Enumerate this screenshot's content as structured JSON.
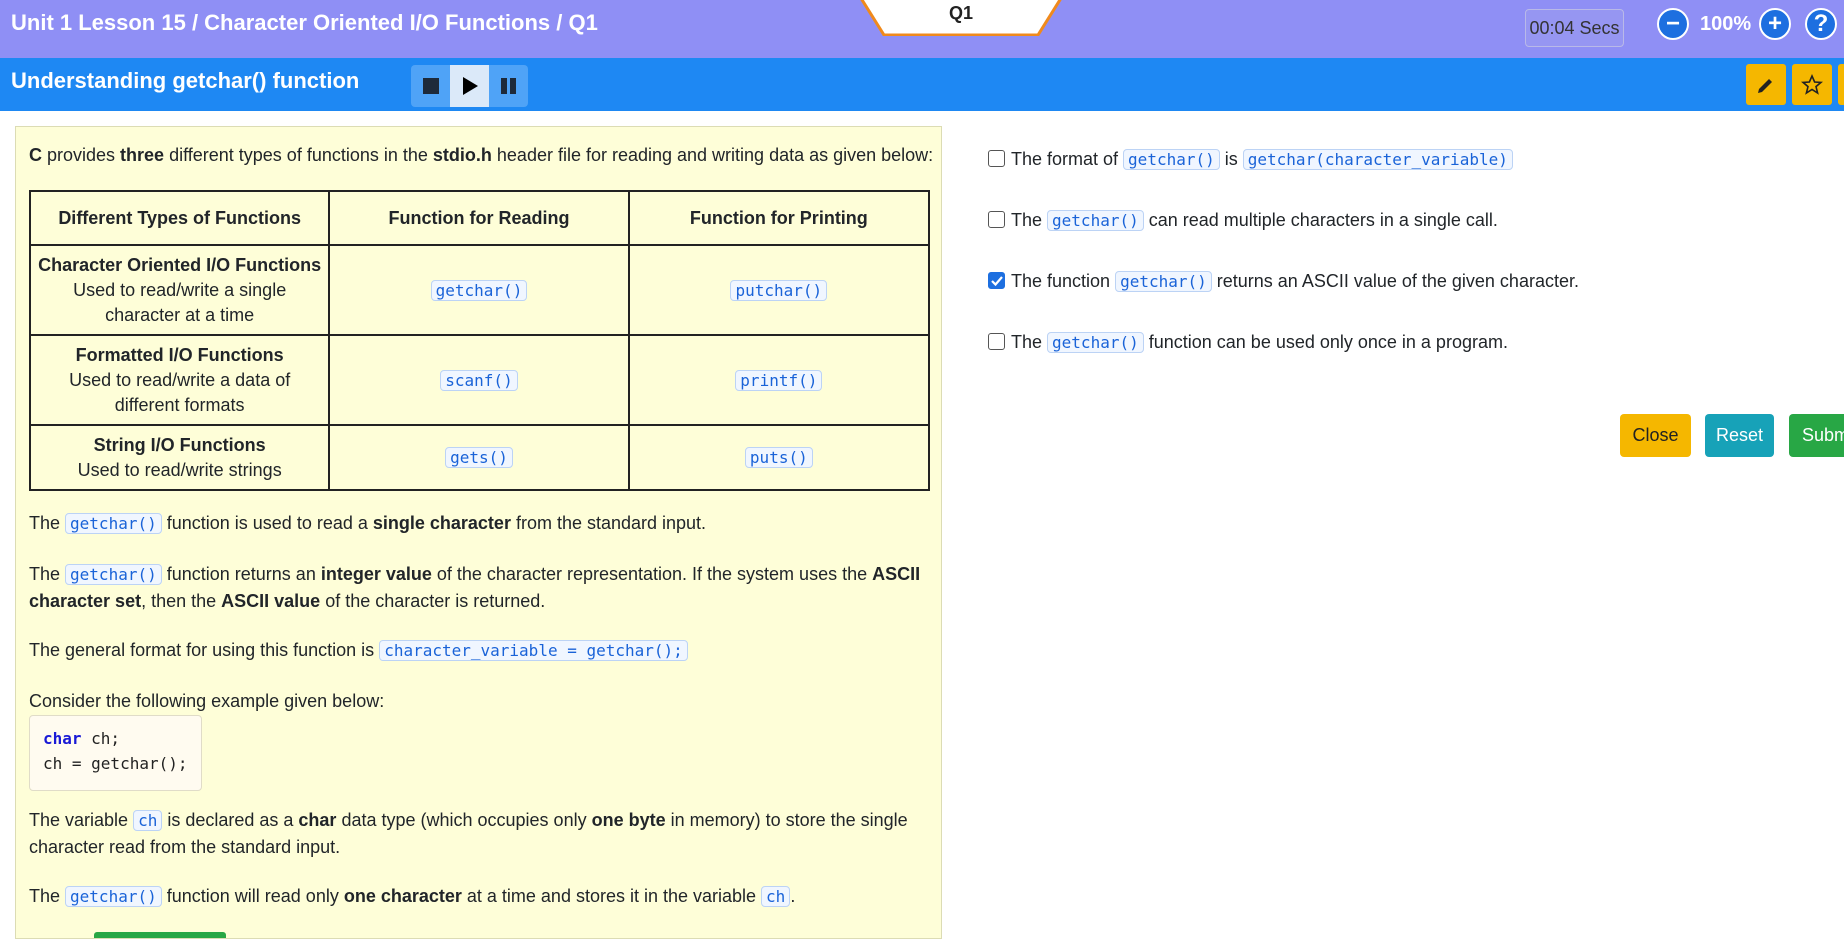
{
  "header": {
    "breadcrumb": "Unit 1 Lesson 15 / Character Oriented I/O Functions / Q1",
    "question_tab": "Q1",
    "timer": "00:04 Secs",
    "zoom": "100%",
    "zoom_out_glyph": "−",
    "zoom_in_glyph": "+",
    "help_glyph": "?"
  },
  "subheader": {
    "title": "Understanding getchar() function"
  },
  "content": {
    "intro": {
      "p1": "C",
      "p2": " provides ",
      "p3": "three",
      "p4": " different types of functions in the ",
      "p5": "stdio.h",
      "p6": " header file for reading and writing data as given below:"
    },
    "table": {
      "headers": [
        "Different Types of Functions",
        "Function for Reading",
        "Function for Printing"
      ],
      "rows": [
        {
          "name": "Character Oriented I/O Functions",
          "desc": "Used to read/write a single character at a time",
          "read": "getchar()",
          "print": "putchar()"
        },
        {
          "name": "Formatted I/O Functions",
          "desc": "Used to read/write a data of different formats",
          "read": "scanf()",
          "print": "printf()"
        },
        {
          "name": "String I/O Functions",
          "desc": "Used to read/write strings",
          "read": "gets()",
          "print": "puts()"
        }
      ]
    },
    "para1": {
      "a": "The ",
      "code": "getchar()",
      "b": " function is used to read a ",
      "c": "single character",
      "d": " from the standard input."
    },
    "para2": {
      "a": "The ",
      "code": "getchar()",
      "b": " function returns an ",
      "c": "integer value",
      "d": " of the character representation. If the system uses the ",
      "e": "ASCII character set",
      "f": ", then the ",
      "g": "ASCII value",
      "h": " of the character is returned."
    },
    "para3": {
      "a": "The general format for using this function is ",
      "code": "character_variable = getchar();"
    },
    "para4": "Consider the following example given below:",
    "code_lines": {
      "kw": "char",
      "l1": " ch;",
      "l2": "ch = getchar();"
    },
    "para5": {
      "a": "The variable ",
      "code": "ch",
      "b": " is declared as a ",
      "c": "char",
      "d": " data type (which occupies only ",
      "e": "one byte",
      "f": " in memory) to store the single character read from the standard input."
    },
    "para6": {
      "a": "The ",
      "code": "getchar()",
      "b": " function will read only ",
      "c": "one character",
      "d": " at a time and stores it in the variable ",
      "code2": "ch",
      "e": "."
    }
  },
  "options": [
    {
      "checked": false,
      "a": "The format of ",
      "code": "getchar()",
      "b": " is ",
      "code2": "getchar(character_variable)",
      "c": ""
    },
    {
      "checked": false,
      "a": "The ",
      "code": "getchar()",
      "b": " can read multiple characters in a single call.",
      "code2": "",
      "c": ""
    },
    {
      "checked": true,
      "a": "The function ",
      "code": "getchar()",
      "b": " returns an ASCII value of the given character.",
      "code2": "",
      "c": ""
    },
    {
      "checked": false,
      "a": "The ",
      "code": "getchar()",
      "b": " function can be used only once in a program.",
      "code2": "",
      "c": ""
    }
  ],
  "actions": {
    "close": "Close",
    "reset": "Reset",
    "submit": "Submit"
  },
  "colors": {
    "topbar": "#8f8ff5",
    "subbar": "#1e88f3",
    "panel": "#fefed8",
    "close": "#f5b700",
    "reset": "#17a2b8",
    "submit": "#28a745",
    "tab_border": "#f08a1c"
  },
  "icons": {
    "stop": "stop-icon",
    "play": "play-icon",
    "pause": "pause-icon",
    "pencil": "pencil-icon",
    "star": "star-icon"
  }
}
